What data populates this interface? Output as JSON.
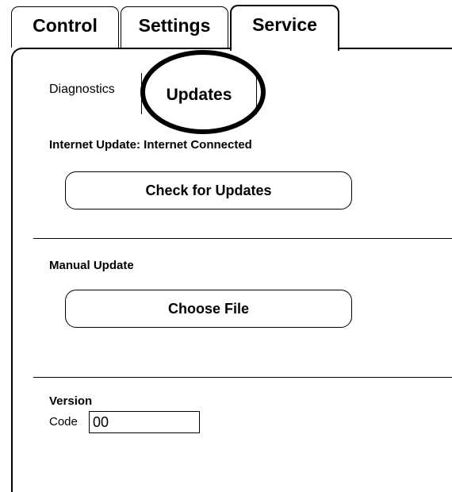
{
  "tabs": {
    "control": "Control",
    "settings": "Settings",
    "service": "Service"
  },
  "subtabs": {
    "diagnostics": "Diagnostics",
    "updates": "Updates"
  },
  "internet_update": {
    "status_label": "Internet Update: Internet Connected",
    "check_button": "Check for Updates"
  },
  "manual_update": {
    "label": "Manual Update",
    "choose_button": "Choose File"
  },
  "version": {
    "label": "Version",
    "code_label": "Code",
    "code_value": "00"
  },
  "colors": {
    "line": "#000000",
    "background": "#ffffff"
  }
}
